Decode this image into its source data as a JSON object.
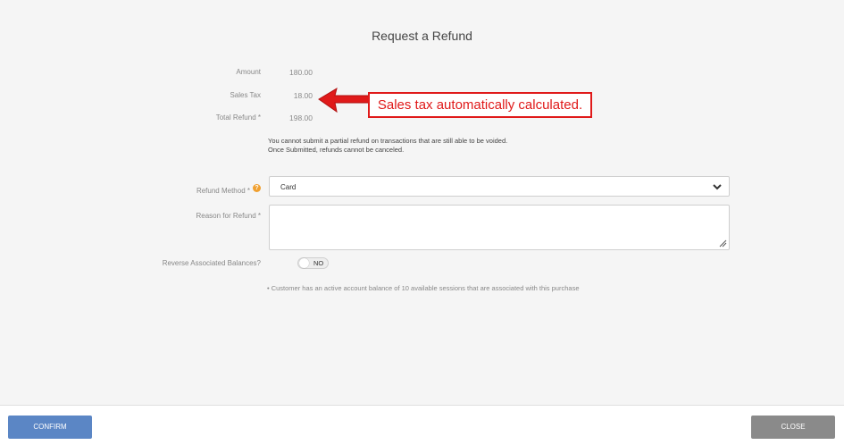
{
  "dialog": {
    "title": "Request a Refund"
  },
  "summary": {
    "amount_label": "Amount",
    "amount_value": "180.00",
    "sales_tax_label": "Sales Tax",
    "sales_tax_value": "18.00",
    "total_label": "Total Refund *",
    "total_value": "198.00"
  },
  "notes": {
    "line1": "You cannot submit a partial refund on transactions that are still able to be voided.",
    "line2": "Once Submitted, refunds cannot be canceled."
  },
  "form": {
    "refund_method_label": "Refund Method *",
    "refund_method_value": "Card",
    "help_icon": "help-icon",
    "reason_label": "Reason for Refund *",
    "reason_value": "",
    "reverse_label": "Reverse Associated Balances?",
    "reverse_toggle_text": "NO",
    "info_bullet": "•   Customer has an active account balance of 10 available sessions that are associated with this purchase"
  },
  "annotation": {
    "callout_text": "Sales tax automatically calculated.",
    "color": "#e01a1a"
  },
  "footer": {
    "confirm_label": "CONFIRM",
    "close_label": "CLOSE",
    "confirm_color": "#5b86c5",
    "close_color": "#8a8a8a"
  }
}
